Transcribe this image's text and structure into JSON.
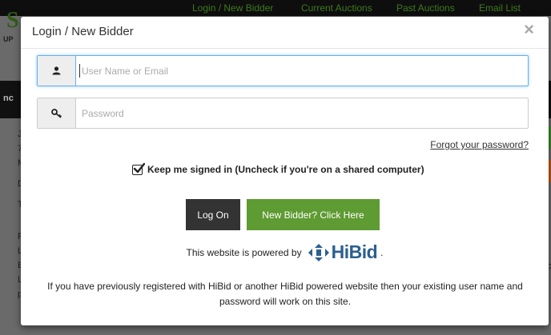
{
  "background": {
    "nav": [
      "Login / New Bidder",
      "Current Auctions",
      "Past Auctions",
      "Email List"
    ]
  },
  "modal": {
    "title": "Login / New Bidder",
    "close_label": "×",
    "username": {
      "placeholder": "User Name or Email",
      "value": ""
    },
    "password": {
      "placeholder": "Password",
      "value": ""
    },
    "forgot_link": "Forgot your password?",
    "remember": {
      "label": "Keep me signed in (Uncheck if you're on a shared computer)",
      "checked": true
    },
    "logon_button": "Log On",
    "new_bidder_button": "New Bidder? Click Here",
    "powered_by": "This website is powered by",
    "powered_logo": "HiBid",
    "powered_suffix": ".",
    "footer_note": "If you have previously registered with HiBid or another HiBid powered website then your existing user name and password will work on this site."
  },
  "colors": {
    "logon_bg": "#333333",
    "new_bidder_bg": "#5e9b32",
    "hibid_blue": "#2c5f8f",
    "focus_border": "#66afe9"
  },
  "icons": {
    "username": "user-icon",
    "password": "key-icon",
    "checkbox": "check-icon",
    "close": "close-icon"
  }
}
